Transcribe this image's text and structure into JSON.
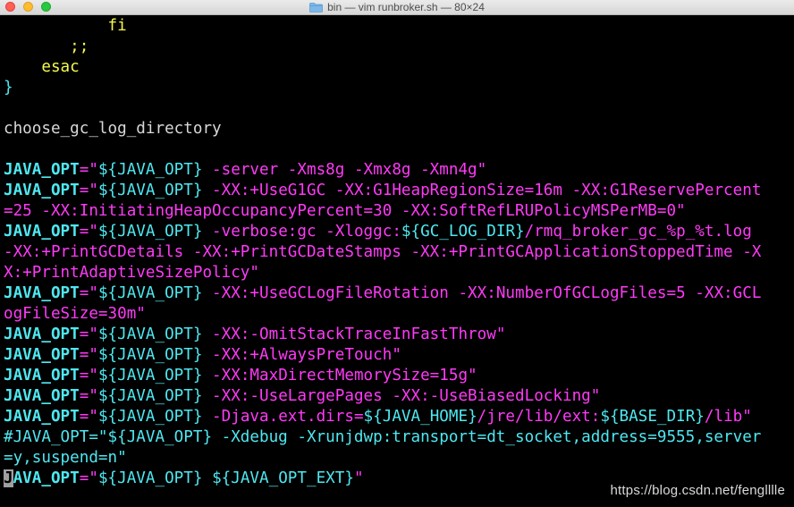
{
  "window": {
    "title": "bin — vim runbroker.sh — 80×24",
    "folder_icon": "folder-icon"
  },
  "colors": {
    "background": "#000000",
    "keyword": "#f6f94d",
    "variable": "#4ee8f1",
    "string": "#ff3af7",
    "plain": "#d8d8d8",
    "cursor": "#a0a0a0"
  },
  "lines": [
    {
      "row": 0,
      "tokens": [
        {
          "t": "           fi",
          "c": "keyword"
        }
      ]
    },
    {
      "row": 1,
      "tokens": [
        {
          "t": "       ;;",
          "c": "keyword"
        }
      ]
    },
    {
      "row": 2,
      "tokens": [
        {
          "t": "    esac",
          "c": "keyword"
        }
      ]
    },
    {
      "row": 3,
      "tokens": [
        {
          "t": "}",
          "c": "variable"
        }
      ]
    },
    {
      "row": 4,
      "tokens": []
    },
    {
      "row": 5,
      "tokens": [
        {
          "t": "choose_gc_log_directory",
          "c": "plain"
        }
      ]
    },
    {
      "row": 6,
      "tokens": []
    },
    {
      "row": 7,
      "tokens": [
        {
          "t": "JAVA_OPT",
          "c": "variable",
          "b": true
        },
        {
          "t": "=\"",
          "c": "string"
        },
        {
          "t": "${JAVA_OPT}",
          "c": "variable"
        },
        {
          "t": " -server -Xms8g -Xmx8g -Xmn4g\"",
          "c": "string"
        }
      ]
    },
    {
      "row": 8,
      "tokens": [
        {
          "t": "JAVA_OPT",
          "c": "variable",
          "b": true
        },
        {
          "t": "=\"",
          "c": "string"
        },
        {
          "t": "${JAVA_OPT}",
          "c": "variable"
        },
        {
          "t": " -XX:+UseG1GC -XX:G1HeapRegionSize=16m -XX:G1ReservePercent",
          "c": "string"
        }
      ]
    },
    {
      "row": 9,
      "tokens": [
        {
          "t": "=25 -XX:InitiatingHeapOccupancyPercent=30 -XX:SoftRefLRUPolicyMSPerMB=0\"",
          "c": "string"
        }
      ]
    },
    {
      "row": 10,
      "tokens": [
        {
          "t": "JAVA_OPT",
          "c": "variable",
          "b": true
        },
        {
          "t": "=\"",
          "c": "string"
        },
        {
          "t": "${JAVA_OPT}",
          "c": "variable"
        },
        {
          "t": " -verbose:gc -Xloggc:",
          "c": "string"
        },
        {
          "t": "${GC_LOG_DIR}",
          "c": "variable"
        },
        {
          "t": "/rmq_broker_gc_%p_%t.log",
          "c": "string"
        }
      ]
    },
    {
      "row": 11,
      "tokens": [
        {
          "t": "-XX:+PrintGCDetails -XX:+PrintGCDateStamps -XX:+PrintGCApplicationStoppedTime -X",
          "c": "string"
        }
      ]
    },
    {
      "row": 12,
      "tokens": [
        {
          "t": "X:+PrintAdaptiveSizePolicy\"",
          "c": "string"
        }
      ]
    },
    {
      "row": 13,
      "tokens": [
        {
          "t": "JAVA_OPT",
          "c": "variable",
          "b": true
        },
        {
          "t": "=\"",
          "c": "string"
        },
        {
          "t": "${JAVA_OPT}",
          "c": "variable"
        },
        {
          "t": " -XX:+UseGCLogFileRotation -XX:NumberOfGCLogFiles=5 -XX:GCL",
          "c": "string"
        }
      ]
    },
    {
      "row": 14,
      "tokens": [
        {
          "t": "ogFileSize=30m\"",
          "c": "string"
        }
      ]
    },
    {
      "row": 15,
      "tokens": [
        {
          "t": "JAVA_OPT",
          "c": "variable",
          "b": true
        },
        {
          "t": "=\"",
          "c": "string"
        },
        {
          "t": "${JAVA_OPT}",
          "c": "variable"
        },
        {
          "t": " -XX:-OmitStackTraceInFastThrow\"",
          "c": "string"
        }
      ]
    },
    {
      "row": 16,
      "tokens": [
        {
          "t": "JAVA_OPT",
          "c": "variable",
          "b": true
        },
        {
          "t": "=\"",
          "c": "string"
        },
        {
          "t": "${JAVA_OPT}",
          "c": "variable"
        },
        {
          "t": " -XX:+AlwaysPreTouch\"",
          "c": "string"
        }
      ]
    },
    {
      "row": 17,
      "tokens": [
        {
          "t": "JAVA_OPT",
          "c": "variable",
          "b": true
        },
        {
          "t": "=\"",
          "c": "string"
        },
        {
          "t": "${JAVA_OPT}",
          "c": "variable"
        },
        {
          "t": " -XX:MaxDirectMemorySize=15g\"",
          "c": "string"
        }
      ]
    },
    {
      "row": 18,
      "tokens": [
        {
          "t": "JAVA_OPT",
          "c": "variable",
          "b": true
        },
        {
          "t": "=\"",
          "c": "string"
        },
        {
          "t": "${JAVA_OPT}",
          "c": "variable"
        },
        {
          "t": " -XX:-UseLargePages -XX:-UseBiasedLocking\"",
          "c": "string"
        }
      ]
    },
    {
      "row": 19,
      "tokens": [
        {
          "t": "JAVA_OPT",
          "c": "variable",
          "b": true
        },
        {
          "t": "=\"",
          "c": "string"
        },
        {
          "t": "${JAVA_OPT}",
          "c": "variable"
        },
        {
          "t": " -Djava.ext.dirs=",
          "c": "string"
        },
        {
          "t": "${JAVA_HOME}",
          "c": "variable"
        },
        {
          "t": "/jre/lib/ext:",
          "c": "string"
        },
        {
          "t": "${BASE_DIR}",
          "c": "variable"
        },
        {
          "t": "/lib\"",
          "c": "string"
        }
      ]
    },
    {
      "row": 20,
      "tokens": [
        {
          "t": "#JAVA_OPT=\"${JAVA_OPT} -Xdebug -Xrunjdwp:transport=dt_socket,address=9555,server",
          "c": "variable"
        }
      ]
    },
    {
      "row": 21,
      "tokens": [
        {
          "t": "=y,suspend=n\"",
          "c": "variable"
        }
      ]
    },
    {
      "row": 22,
      "tokens": [
        {
          "t": "J",
          "c": "variable",
          "b": true,
          "cursor": true
        },
        {
          "t": "AVA_OPT",
          "c": "variable",
          "b": true
        },
        {
          "t": "=\"",
          "c": "string"
        },
        {
          "t": "${JAVA_OPT}",
          "c": "variable"
        },
        {
          "t": " ",
          "c": "string"
        },
        {
          "t": "${JAVA_OPT_EXT}",
          "c": "variable"
        },
        {
          "t": "\"",
          "c": "string"
        }
      ]
    }
  ],
  "watermark": "https://blog.csdn.net/fenglllle"
}
